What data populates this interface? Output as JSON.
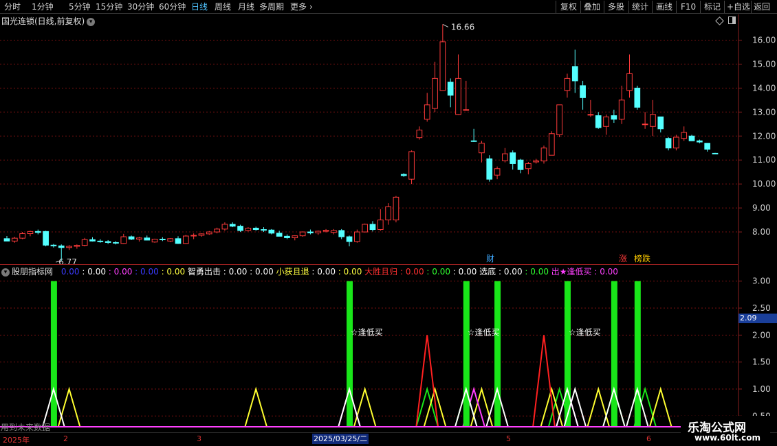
{
  "toolbar": {
    "periods": [
      "分时",
      "1分钟",
      "5分钟",
      "15分钟",
      "30分钟",
      "60分钟",
      "日线",
      "周线",
      "月线",
      "多周期",
      "更多"
    ],
    "more_arrow": "›",
    "active_period": "日线",
    "actions": [
      "复权",
      "叠加",
      "多股",
      "统计",
      "画线",
      "F10",
      "标记",
      "+自选",
      "返回"
    ]
  },
  "main_chart": {
    "title": "国光连锁(日线,前复权)",
    "icons": [
      "diamond-icon",
      "layout-icon"
    ],
    "y_ticks": [
      "16.00",
      "15.00",
      "14.00",
      "13.00",
      "12.00",
      "11.00",
      "10.00",
      "9.00",
      "8.00"
    ],
    "high_annotation": "16.66",
    "low_annotation": "6.77",
    "markers": [
      {
        "text": "财",
        "color": "#3fa9ff"
      },
      {
        "text": "涨",
        "color": "#ff3a3a"
      },
      {
        "text": "榜跌",
        "color": "#ffcc00"
      }
    ]
  },
  "indicator": {
    "name": "股朋指标网",
    "legend": [
      {
        "text": "0.00",
        "color": "#3a3aff"
      },
      {
        "text": ": 0.00",
        "color": "#ffffff"
      },
      {
        "text": ": 0.00",
        "color": "#ff40ff"
      },
      {
        "text": ": 0.00",
        "color": "#3a3aff"
      },
      {
        "text": ": 0.00",
        "color": "#ffff40"
      },
      {
        "text": "智勇出击",
        "color": "#ffffff"
      },
      {
        "text": ": 0.00",
        "color": "#ffffff"
      },
      {
        "text": ": 0.00",
        "color": "#ffffff"
      },
      {
        "text": "小获且退",
        "color": "#ffff40"
      },
      {
        "text": ": 0.00",
        "color": "#ffffff"
      },
      {
        "text": ": 0.00",
        "color": "#ffff40"
      },
      {
        "text": "大胜且归",
        "color": "#ff3030"
      },
      {
        "text": ": 0.00",
        "color": "#ff3030"
      },
      {
        "text": ": 0.00",
        "color": "#30ff30"
      },
      {
        "text": ": 0.00",
        "color": "#ffffff"
      },
      {
        "text": "选底",
        "color": "#ffffff"
      },
      {
        "text": ": 0.00",
        "color": "#ffffff"
      },
      {
        "text": ": 0.00",
        "color": "#30ff30"
      },
      {
        "text": "出★逢低买",
        "color": "#ff40ff"
      },
      {
        "text": ": 0.00",
        "color": "#ff40ff"
      }
    ],
    "y_ticks": [
      "3.00",
      "2.50",
      "2.00",
      "1.50",
      "1.00",
      "0.50"
    ],
    "y_badge": "2.09",
    "signal_text": "☆逢低买",
    "footer_note": "用到未来数据"
  },
  "bottom_axis": {
    "labels": [
      "2025年",
      "2",
      "3",
      "5",
      "6"
    ],
    "cursor_date": "2025/03/25/二"
  },
  "watermark": {
    "line1": "乐淘公式网",
    "line2": "www.60lt.com"
  },
  "chart_data": [
    {
      "type": "candlestick",
      "title": "国光连锁(日线,前复权)",
      "ylim": [
        7.0,
        16.9
      ],
      "ohlc": [
        [
          7.72,
          7.83,
          7.62,
          7.62
        ],
        [
          7.62,
          7.8,
          7.55,
          7.74
        ],
        [
          7.74,
          8.0,
          7.7,
          7.93
        ],
        [
          7.93,
          8.05,
          7.82,
          8.02
        ],
        [
          8.02,
          8.1,
          7.9,
          7.98
        ],
        [
          8.02,
          8.05,
          7.4,
          7.45
        ],
        [
          7.45,
          7.5,
          7.35,
          7.42
        ],
        [
          7.42,
          7.48,
          6.8,
          7.35
        ],
        [
          7.35,
          7.45,
          7.25,
          7.4
        ],
        [
          7.4,
          7.48,
          7.3,
          7.44
        ],
        [
          7.44,
          7.75,
          7.4,
          7.68
        ],
        [
          7.68,
          7.78,
          7.6,
          7.62
        ],
        [
          7.62,
          7.7,
          7.55,
          7.6
        ],
        [
          7.6,
          7.66,
          7.5,
          7.56
        ],
        [
          7.56,
          7.62,
          7.48,
          7.54
        ],
        [
          7.52,
          7.92,
          7.5,
          7.8
        ],
        [
          7.8,
          7.85,
          7.66,
          7.7
        ],
        [
          7.7,
          7.8,
          7.6,
          7.75
        ],
        [
          7.75,
          7.85,
          7.65,
          7.66
        ],
        [
          7.58,
          7.72,
          7.55,
          7.7
        ],
        [
          7.7,
          7.78,
          7.62,
          7.68
        ],
        [
          7.62,
          7.74,
          7.58,
          7.72
        ],
        [
          7.72,
          7.82,
          7.5,
          7.52
        ],
        [
          7.52,
          7.88,
          7.5,
          7.83
        ],
        [
          7.83,
          7.94,
          7.7,
          7.86
        ],
        [
          7.86,
          7.94,
          7.8,
          7.92
        ],
        [
          7.92,
          8.04,
          7.88,
          8.0
        ],
        [
          8.0,
          8.18,
          7.94,
          8.12
        ],
        [
          8.12,
          8.4,
          8.05,
          8.32
        ],
        [
          8.32,
          8.4,
          8.2,
          8.24
        ],
        [
          8.24,
          8.3,
          8.0,
          8.06
        ],
        [
          8.06,
          8.2,
          8.02,
          8.16
        ],
        [
          8.16,
          8.22,
          8.05,
          8.1
        ],
        [
          8.1,
          8.2,
          8.0,
          8.08
        ],
        [
          8.08,
          8.12,
          7.9,
          7.95
        ],
        [
          7.95,
          8.05,
          7.85,
          7.82
        ],
        [
          7.82,
          7.9,
          7.7,
          7.76
        ],
        [
          7.76,
          7.86,
          7.65,
          7.84
        ],
        [
          7.84,
          8.02,
          7.8,
          8.0
        ],
        [
          8.0,
          8.1,
          7.9,
          7.96
        ],
        [
          7.96,
          8.06,
          7.88,
          8.03
        ],
        [
          8.03,
          8.12,
          7.98,
          8.07
        ],
        [
          7.98,
          8.12,
          7.9,
          8.06
        ],
        [
          8.06,
          8.12,
          7.7,
          7.8
        ],
        [
          7.8,
          7.85,
          7.4,
          7.6
        ],
        [
          7.6,
          8.1,
          7.55,
          8.0
        ],
        [
          8.0,
          8.35,
          7.98,
          8.32
        ],
        [
          8.32,
          8.45,
          8.02,
          8.1
        ],
        [
          8.1,
          8.95,
          8.05,
          8.5
        ],
        [
          8.5,
          9.2,
          8.3,
          9.05
        ],
        [
          8.5,
          9.5,
          8.4,
          9.45
        ],
        [
          10.4,
          10.45,
          10.3,
          10.35
        ],
        [
          10.2,
          11.4,
          10.0,
          11.35
        ],
        [
          11.93,
          12.4,
          11.85,
          12.25
        ],
        [
          12.7,
          13.8,
          12.6,
          13.3
        ],
        [
          13.15,
          15.1,
          13.0,
          14.4
        ],
        [
          13.9,
          16.66,
          13.9,
          15.93
        ],
        [
          14.25,
          14.4,
          13.2,
          13.7
        ],
        [
          12.9,
          15.4,
          12.88,
          14.4
        ],
        [
          13.1,
          14.3,
          13.1,
          13.1
        ],
        [
          11.8,
          12.3,
          11.75,
          11.78
        ],
        [
          11.3,
          11.8,
          10.9,
          11.7
        ],
        [
          11.05,
          11.2,
          10.1,
          10.2
        ],
        [
          10.37,
          10.73,
          10.2,
          10.64
        ],
        [
          10.97,
          11.5,
          10.9,
          11.26
        ],
        [
          11.3,
          11.4,
          10.6,
          10.85
        ],
        [
          11.0,
          11.05,
          10.45,
          10.6
        ],
        [
          10.64,
          10.92,
          10.4,
          10.85
        ],
        [
          10.92,
          11.05,
          10.85,
          10.96
        ],
        [
          10.96,
          11.6,
          10.85,
          11.5
        ],
        [
          11.2,
          12.2,
          11.2,
          12.1
        ],
        [
          12.05,
          13.3,
          11.95,
          13.3
        ],
        [
          13.9,
          14.6,
          13.6,
          14.4
        ],
        [
          14.9,
          15.6,
          13.8,
          14.3
        ],
        [
          14.1,
          14.3,
          13.1,
          13.6
        ],
        [
          12.9,
          13.5,
          12.8,
          12.9
        ],
        [
          12.85,
          13.0,
          12.3,
          12.35
        ],
        [
          12.4,
          12.9,
          12.05,
          12.8
        ],
        [
          12.85,
          13.1,
          12.55,
          12.7
        ],
        [
          12.7,
          14.1,
          12.5,
          13.5
        ],
        [
          13.9,
          15.4,
          13.6,
          14.6
        ],
        [
          14.0,
          14.1,
          13.1,
          13.2
        ],
        [
          12.5,
          13.0,
          12.3,
          12.5
        ],
        [
          12.4,
          13.5,
          12.0,
          12.9
        ],
        [
          12.8,
          12.8,
          12.15,
          12.3
        ],
        [
          11.9,
          11.95,
          11.4,
          11.5
        ],
        [
          11.5,
          12.05,
          11.4,
          11.95
        ],
        [
          11.9,
          12.4,
          11.8,
          12.15
        ],
        [
          12.0,
          12.05,
          11.8,
          11.8
        ],
        [
          11.8,
          11.85,
          11.7,
          11.75
        ],
        [
          11.7,
          11.7,
          11.35,
          11.45
        ],
        [
          11.28,
          11.3,
          11.25,
          11.26
        ]
      ]
    },
    {
      "type": "bar",
      "title": "股朋指标网",
      "ylim": [
        0.3,
        3.2
      ],
      "series": [
        {
          "name": "智勇出击",
          "values": [
            3,
            3,
            3,
            3,
            3,
            3,
            3
          ]
        },
        {
          "name": "选底",
          "values": [
            1,
            1,
            1,
            1,
            1,
            1,
            1,
            1
          ]
        },
        {
          "name": "小获且退",
          "values": [
            1,
            1,
            1,
            1,
            1,
            1
          ]
        },
        {
          "name": "大胜且归",
          "values": [
            2,
            2
          ]
        },
        {
          "name": "出★逢低买",
          "values": [
            1,
            1,
            1
          ]
        }
      ],
      "signal_count": 3
    }
  ]
}
